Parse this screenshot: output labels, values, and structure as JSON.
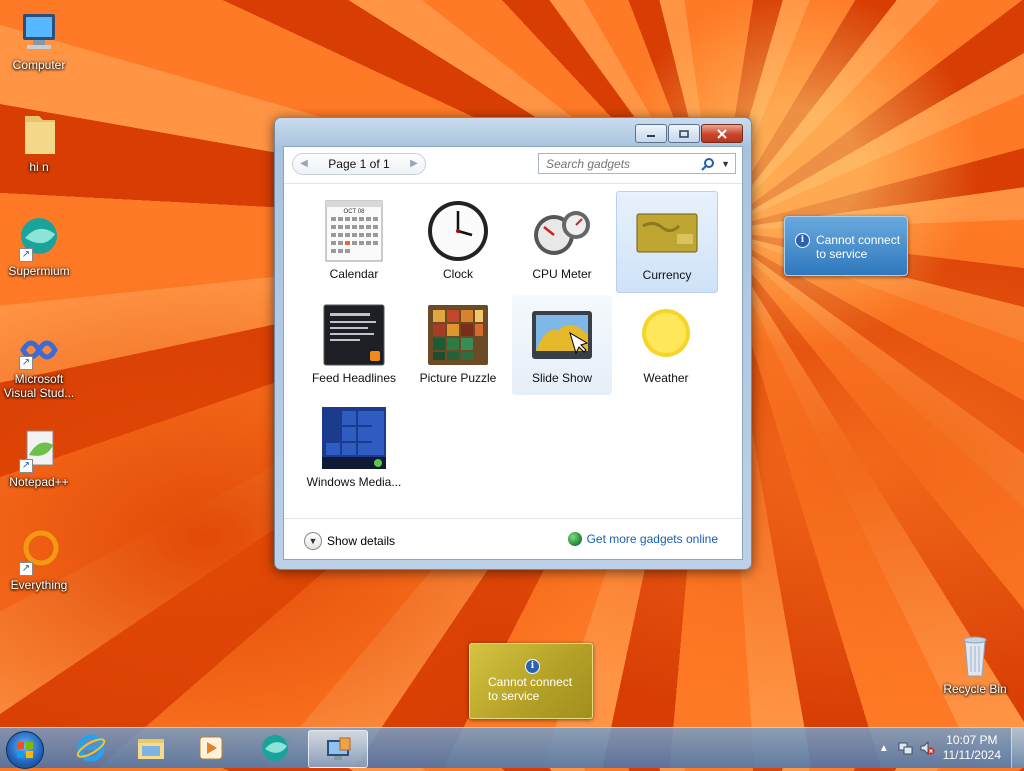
{
  "desktop": {
    "icons": [
      {
        "label": "Computer"
      },
      {
        "label": "hi n"
      },
      {
        "label": "Supermium"
      },
      {
        "label": "Microsoft Visual Stud..."
      },
      {
        "label": "Notepad++"
      },
      {
        "label": "Everything"
      },
      {
        "label": "Recycle Bin"
      }
    ],
    "gadget_messages": [
      {
        "text": "Cannot connect to service"
      },
      {
        "text": "Cannot connect to service"
      }
    ]
  },
  "gadget_window": {
    "pager": {
      "label": "Page 1 of 1"
    },
    "search": {
      "placeholder": "Search gadgets"
    },
    "gadgets": [
      {
        "label": "Calendar"
      },
      {
        "label": "Clock"
      },
      {
        "label": "CPU Meter"
      },
      {
        "label": "Currency"
      },
      {
        "label": "Feed Headlines"
      },
      {
        "label": "Picture Puzzle"
      },
      {
        "label": "Slide Show"
      },
      {
        "label": "Weather"
      },
      {
        "label": "Windows Media..."
      }
    ],
    "calendar_month": "OCT 08",
    "footer": {
      "details_label": "Show details",
      "online_label": "Get more gadgets online"
    }
  },
  "taskbar": {
    "clock": {
      "time": "10:07 PM",
      "date": "11/11/2024"
    }
  },
  "colors": {
    "link": "#1a5fb4",
    "selected_tile": "#cfe2f8",
    "taskbar": "#5078aa"
  }
}
